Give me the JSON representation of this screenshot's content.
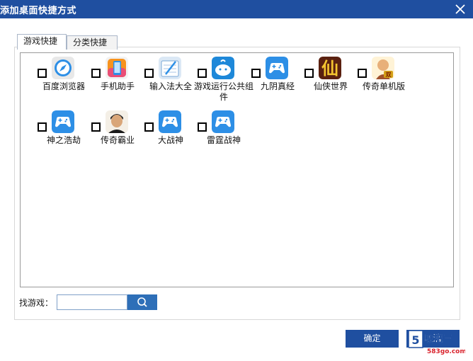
{
  "window": {
    "title": "添加桌面快捷方式"
  },
  "tabs": [
    {
      "label": "游戏快捷"
    },
    {
      "label": "分类快捷"
    }
  ],
  "games": [
    {
      "name": "百度浏览器",
      "icon": "compass-icon",
      "checked": false
    },
    {
      "name": "手机助手",
      "icon": "phone-icon",
      "checked": false
    },
    {
      "name": "输入法大全",
      "icon": "keyboard-icon",
      "checked": false
    },
    {
      "name": "游戏运行公共组件",
      "icon": "whale-icon",
      "checked": false
    },
    {
      "name": "九阴真经",
      "icon": "gamepad-icon",
      "checked": false
    },
    {
      "name": "仙侠世界",
      "icon": "xian-logo-icon",
      "checked": false
    },
    {
      "name": "传奇单机版",
      "icon": "warrior-avatar-icon",
      "checked": false
    },
    {
      "name": "神之浩劫",
      "icon": "gamepad-icon",
      "checked": false
    },
    {
      "name": "传奇霸业",
      "icon": "man-avatar-icon",
      "checked": false
    },
    {
      "name": "大战神",
      "icon": "gamepad-icon",
      "checked": false
    },
    {
      "name": "雷霆战神",
      "icon": "gamepad-icon",
      "checked": false
    }
  ],
  "xian_logo_text": "仙",
  "warrior_badge_text": "双",
  "search": {
    "label": "找游戏：",
    "value": "",
    "placeholder": ""
  },
  "buttons": {
    "confirm": "确定",
    "cancel": "取消"
  },
  "watermark": {
    "brand": "聊吧三",
    "site": "583go.com"
  },
  "colors": {
    "titlebar": "#1f4fa0",
    "button": "#1f4fa0",
    "icon_blue": "#2d8fe6",
    "search_button": "#2e6fb8"
  }
}
